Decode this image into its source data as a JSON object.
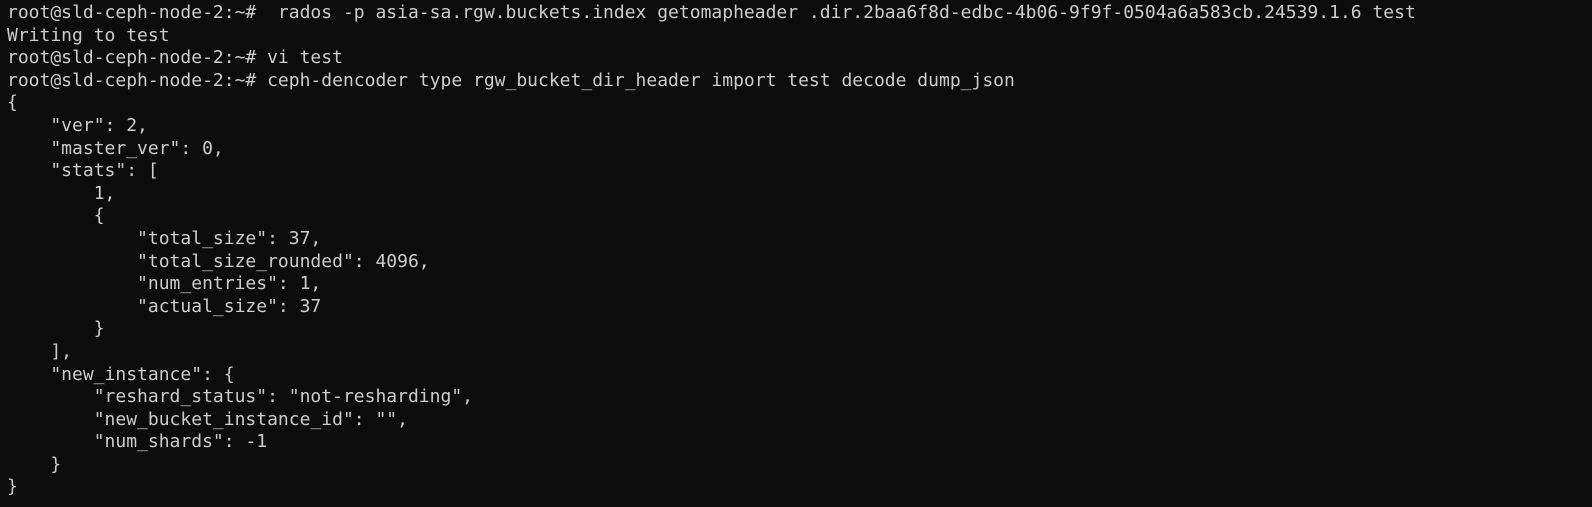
{
  "terminal": {
    "prompt": "root@sld-ceph-node-2:~#",
    "lines": [
      {
        "type": "command",
        "prompt": "root@sld-ceph-node-2:~#",
        "text": "  rados -p asia-sa.rgw.buckets.index getomapheader .dir.2baa6f8d-edbc-4b06-9f9f-0504a6a583cb.24539.1.6 test"
      },
      {
        "type": "output",
        "text": "Writing to test"
      },
      {
        "type": "command",
        "prompt": "root@sld-ceph-node-2:~#",
        "text": " vi test"
      },
      {
        "type": "command",
        "prompt": "root@sld-ceph-node-2:~#",
        "text": " ceph-dencoder type rgw_bucket_dir_header import test decode dump_json"
      },
      {
        "type": "output",
        "text": "{"
      },
      {
        "type": "output",
        "text": "    \"ver\": 2,"
      },
      {
        "type": "output",
        "text": "    \"master_ver\": 0,"
      },
      {
        "type": "output",
        "text": "    \"stats\": ["
      },
      {
        "type": "output",
        "text": "        1,"
      },
      {
        "type": "output",
        "text": "        {"
      },
      {
        "type": "output",
        "text": "            \"total_size\": 37,"
      },
      {
        "type": "output",
        "text": "            \"total_size_rounded\": 4096,"
      },
      {
        "type": "output",
        "text": "            \"num_entries\": 1,"
      },
      {
        "type": "output",
        "text": "            \"actual_size\": 37"
      },
      {
        "type": "output",
        "text": "        }"
      },
      {
        "type": "output",
        "text": "    ],"
      },
      {
        "type": "output",
        "text": "    \"new_instance\": {"
      },
      {
        "type": "output",
        "text": "        \"reshard_status\": \"not-resharding\","
      },
      {
        "type": "output",
        "text": "        \"new_bucket_instance_id\": \"\","
      },
      {
        "type": "output",
        "text": "        \"num_shards\": -1"
      },
      {
        "type": "output",
        "text": "    }"
      },
      {
        "type": "output",
        "text": "}"
      }
    ]
  },
  "colors": {
    "background": "#0c0c0c",
    "foreground": "#cccccc"
  }
}
